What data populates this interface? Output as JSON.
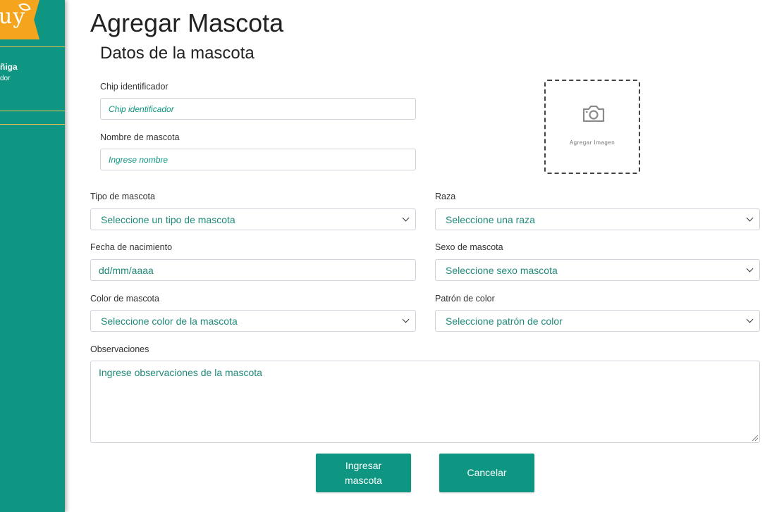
{
  "sidebar": {
    "logo_text": "uy",
    "user_name": "ñiga",
    "user_role": "dor",
    "accent": "#f5a51d",
    "bg": "#0f9682"
  },
  "page": {
    "title": "Agregar Mascota",
    "section_title": "Datos de la mascota"
  },
  "form": {
    "chip": {
      "label": "Chip identificador",
      "placeholder": "Chip identificador"
    },
    "name": {
      "label": "Nombre de mascota",
      "placeholder": "Ingrese nombre"
    },
    "image": {
      "caption": "Agregar Imagen",
      "icon": "camera-icon"
    },
    "type": {
      "label": "Tipo de mascota",
      "selected": "Seleccione un tipo de mascota"
    },
    "breed": {
      "label": "Raza",
      "selected": "Seleccione una raza"
    },
    "birth": {
      "label": "Fecha de nacimiento",
      "value": "dd/mm/aaaa"
    },
    "sex": {
      "label": "Sexo de mascota",
      "selected": "Seleccione sexo mascota"
    },
    "color": {
      "label": "Color de mascota",
      "selected": "Seleccione color de la mascota"
    },
    "pattern": {
      "label": "Patrón de color",
      "selected": "Seleccione patrón de color"
    },
    "notes": {
      "label": "Observaciones",
      "placeholder": "Ingrese observaciones de la mascota"
    }
  },
  "actions": {
    "submit_line1": "Ingresar",
    "submit_line2": "mascota",
    "cancel": "Cancelar"
  }
}
